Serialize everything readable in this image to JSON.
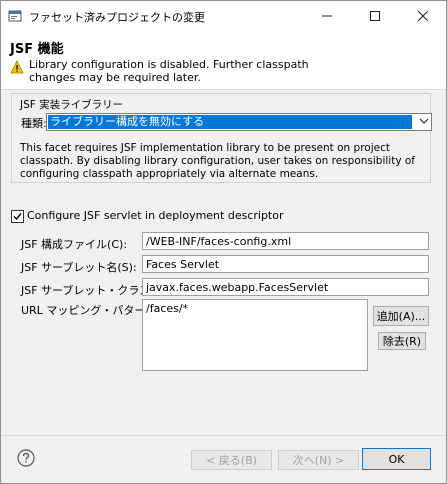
{
  "window": {
    "title": "ファセット済みプロジェクトの変更"
  },
  "header": {
    "title": "JSF 機能",
    "warning": "Library configuration is disabled. Further classpath changes may be required later."
  },
  "implementation": {
    "group_label": "JSF 実装ライブラリー",
    "type_label": "種類:",
    "type_value": "ライブラリー構成を無効にする",
    "description": "This facet requires JSF implementation library to be present on project classpath. By disabling library configuration, user takes on responsibility of configuring classpath appropriately via alternate means."
  },
  "servlet": {
    "configure_label": "Configure JSF servlet in deployment descriptor",
    "configure_checked": true,
    "config_file_label": "JSF 構成ファイル(C):",
    "config_file_value": "/WEB-INF/faces-config.xml",
    "servlet_name_label": "JSF サーブレット名(S):",
    "servlet_name_value": "Faces Servlet",
    "servlet_class_label": "JSF サーブレット・クラス名(L):",
    "servlet_class_value": "javax.faces.webapp.FacesServlet",
    "url_mapping_label": "URL マッピング・パターン(U):",
    "url_patterns": [
      "/faces/*"
    ],
    "add_button": "追加(A)...",
    "remove_button": "除去(R)"
  },
  "footer": {
    "back_button": "< 戻る(B)",
    "next_button": "次へ(N) >",
    "ok_button": "OK"
  },
  "colors": {
    "selection": "#0078d7",
    "warning": "#f5c400",
    "background": "#f0f0f0"
  }
}
